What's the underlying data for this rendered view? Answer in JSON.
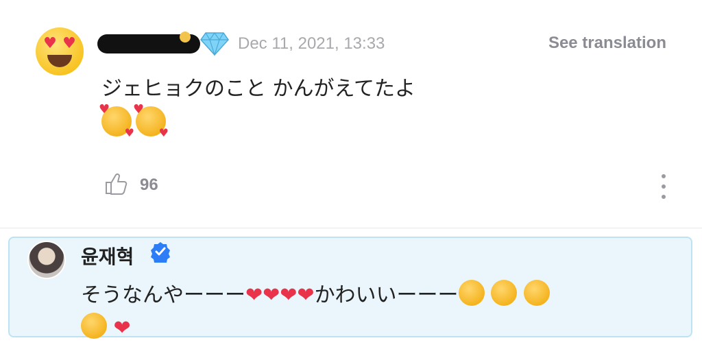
{
  "comment": {
    "timestamp": "Dec 11, 2021, 13:33",
    "see_translation_label": "See translation",
    "text": "ジェヒョクのこと かんがえてたよ",
    "emojis": [
      "smiling-face-with-hearts",
      "smiling-face-with-hearts"
    ],
    "like_count": "96",
    "avatar_icon": "heart-eyes-emoji-icon",
    "badge_icons": [
      "medal-icon",
      "diamond-icon"
    ]
  },
  "reply": {
    "author": "윤재혁",
    "verified": true,
    "text_part1": "そうなんやーーー",
    "text_part2": "かわいいーーー",
    "emojis_part1": [
      "red-heart",
      "red-heart",
      "red-heart",
      "red-heart"
    ],
    "emojis_part2": [
      "smiling-face-with-hearts",
      "smiling-face-with-hearts",
      "smiling-face-with-hearts",
      "smiling-face-with-hearts",
      "red-heart"
    ],
    "box_colors": {
      "background": "#eaf6fb",
      "border": "#bde3f2"
    }
  },
  "colors": {
    "muted_text": "#a8a8ad",
    "verified_blue": "#2d7df6",
    "heart_red": "#e8334a"
  }
}
